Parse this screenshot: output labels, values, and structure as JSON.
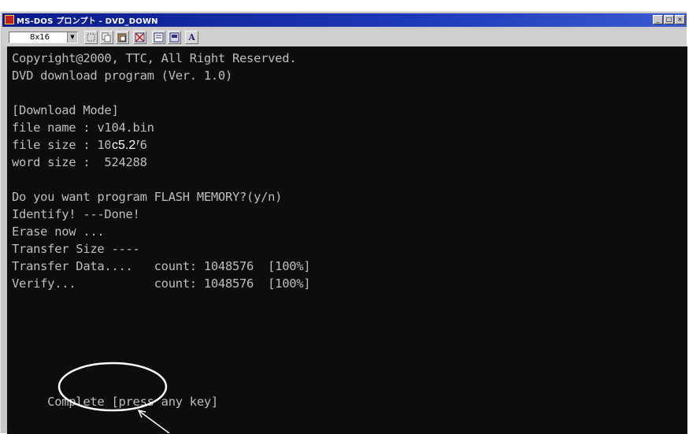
{
  "window": {
    "title": "MS-DOS プロンプト - DVD_DOWN"
  },
  "toolbar": {
    "font_size_label": "8x16",
    "font_button_label": "A"
  },
  "terminal": {
    "lines": [
      "Copyright@2000, TTC, All Right Reserved.",
      "DVD download program (Ver. 1.0)",
      "",
      "[Download Mode]",
      "file name : v104.bin",
      "file size : 1048576",
      "word size :  524288",
      "",
      "Do you want program FLASH MEMORY?(y/n)",
      "Identify! ---Done!",
      "Erase now ...",
      "Transfer Size ----",
      "Transfer Data....   count: 1048576  [100%]",
      "Verify...           count: 1048576  [100%]",
      "",
      "",
      "",
      "",
      "     Complete [press any key]"
    ],
    "overlay_label": "c5.2"
  },
  "colors": {
    "terminal_bg": "#0d0d0d",
    "terminal_fg": "#bdbdbd",
    "title_bar": "#1d3ab8"
  }
}
